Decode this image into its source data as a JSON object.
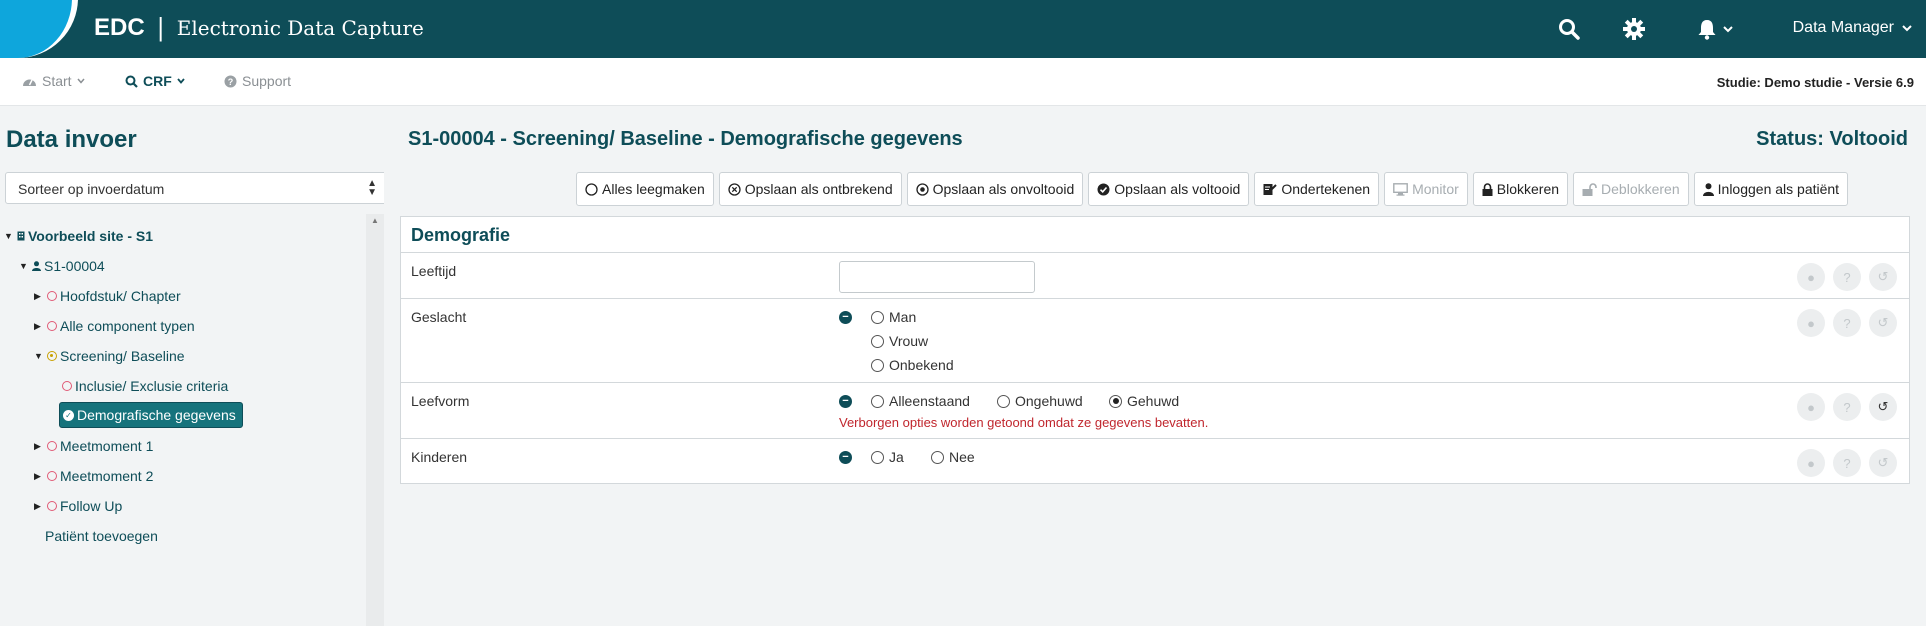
{
  "header": {
    "brand_abbr": "EDC",
    "brand_sep": "|",
    "brand_full": "Electronic Data Capture",
    "user": "Data Manager",
    "icons": [
      "search-icon",
      "gear-icon",
      "bell-icon",
      "chevron-down-icon"
    ],
    "bg_color": "#0e4d58",
    "accent_color": "#0ea6dc"
  },
  "nav": {
    "start": "Start",
    "crf": "CRF",
    "support": "Support",
    "study": "Studie: Demo studie - Versie 6.9"
  },
  "sidebar": {
    "title": "Data invoer",
    "sort_label": "Sorteer op invoerdatum",
    "site": "Voorbeeld site - S1",
    "patient": "S1-00004",
    "items": [
      {
        "label": "Hoofdstuk/ Chapter"
      },
      {
        "label": "Alle component typen"
      },
      {
        "label": "Screening/ Baseline"
      },
      {
        "label": "Inclusie/ Exclusie criteria"
      },
      {
        "label": "Demografische gegevens"
      },
      {
        "label": "Meetmoment 1"
      },
      {
        "label": "Meetmoment 2"
      },
      {
        "label": "Follow Up"
      }
    ],
    "add_patient": "Patiënt toevoegen"
  },
  "main": {
    "title": "S1-00004 - Screening/ Baseline - Demografische gegevens",
    "status": "Status: Voltooid",
    "toolbar": {
      "clear": "Alles leegmaken",
      "save_missing": "Opslaan als ontbrekend",
      "save_incomplete": "Opslaan als onvoltooid",
      "save_complete": "Opslaan als voltooid",
      "sign": "Ondertekenen",
      "monitor": "Monitor",
      "lock": "Blokkeren",
      "unlock": "Deblokkeren",
      "login_patient": "Inloggen als patiënt"
    },
    "section": "Demografie",
    "fields": {
      "age": {
        "label": "Leeftijd",
        "value": ""
      },
      "sex": {
        "label": "Geslacht",
        "options": [
          "Man",
          "Vrouw",
          "Onbekend"
        ],
        "selected": ""
      },
      "living": {
        "label": "Leefvorm",
        "options": [
          "Alleenstaand",
          "Ongehuwd",
          "Gehuwd"
        ],
        "selected": "Gehuwd",
        "warning": "Verborgen opties worden getoond omdat ze gegevens bevatten."
      },
      "children": {
        "label": "Kinderen",
        "options": [
          "Ja",
          "Nee"
        ],
        "selected": ""
      }
    }
  }
}
